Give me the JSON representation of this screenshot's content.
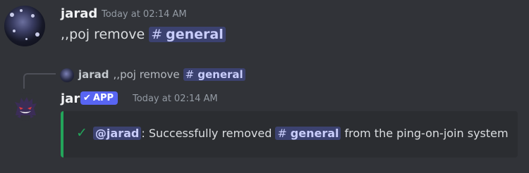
{
  "message1": {
    "author": "jarad",
    "timestamp": "Today at 02:14 AM",
    "text": ",,poj remove",
    "channel_hash": "#",
    "channel_name": "general"
  },
  "reply": {
    "author": "jarad",
    "text": ",,poj remove",
    "channel_hash": "#",
    "channel_name": "general"
  },
  "message2": {
    "author": "jar",
    "badge": "APP",
    "badge_check": "✔",
    "timestamp": "Today at 02:14 AM",
    "embed": {
      "color": "#23a55a",
      "check": "✓",
      "user_mention": "@jarad",
      "text_before_channel": ": Successfully removed",
      "channel_hash": "#",
      "channel_name": "general",
      "text_after_channel": "from the ping-on-join system"
    }
  },
  "colors": {
    "background": "#313338",
    "mention_bg": "#3c4270",
    "app_badge": "#5865f2",
    "embed_bg": "#2b2d31"
  }
}
